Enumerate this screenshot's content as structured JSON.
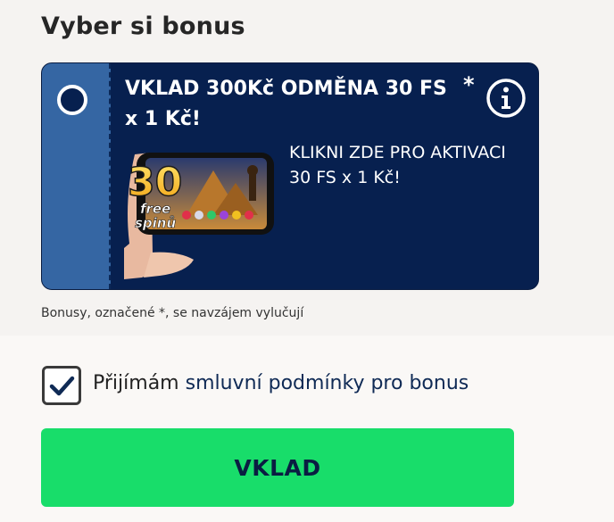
{
  "section": {
    "title": "Vyber si bonus"
  },
  "bonus": {
    "title": "VKLAD 300Kč ODMĚNA 30 FS x 1 Kč!",
    "asterisk": "*",
    "description": "KLIKNI ZDE PRO AKTIVACI 30 FS x 1 Kč!",
    "image": {
      "number": "30",
      "free": "free",
      "spinu": "spinů"
    },
    "selected": false
  },
  "note": "Bonusy, označené *, se navzájem vylučují",
  "terms": {
    "prefix": "Přijímám ",
    "link": "smluvní podmínky pro bonus",
    "checked": true
  },
  "deposit_button": "VKLAD",
  "colors": {
    "card_bg": "#07204f",
    "stub_bg": "#3566a3",
    "button_bg": "#18dd6a",
    "button_text": "#0a1d42"
  }
}
